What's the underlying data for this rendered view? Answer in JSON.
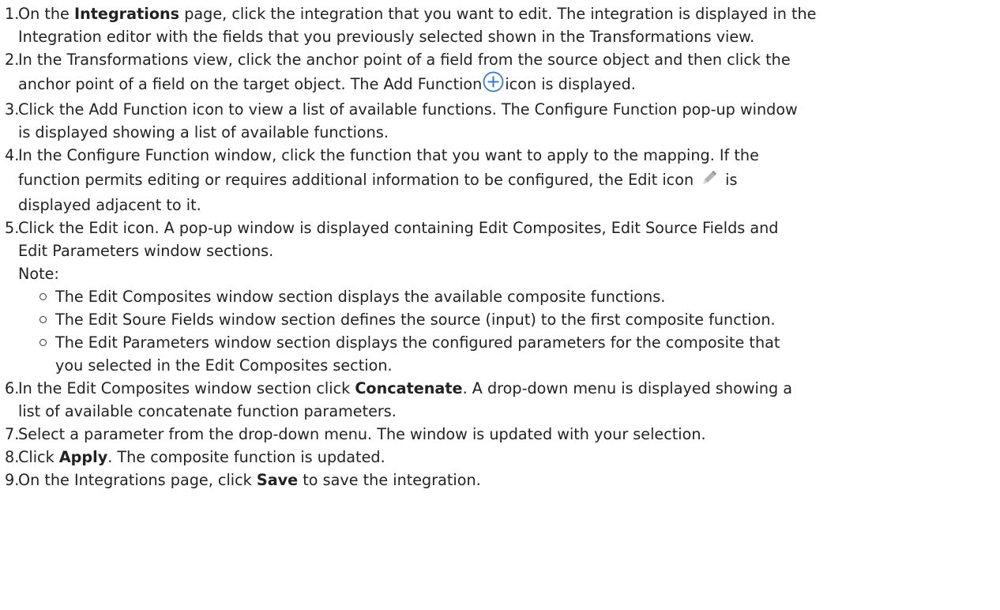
{
  "steps": [
    {
      "num": "1.",
      "a": "On the ",
      "b": "Integrations",
      "c": " page, click the integration that you want to edit. The integration is displayed in the",
      "d": "Integration editor with the fields that you previously selected shown in the Transformations view."
    },
    {
      "num": "2.",
      "a": "In the Transformations view, click the anchor point of a field from the source object and then click the",
      "b": "anchor point of a field on the target object. The Add Function",
      "c": "icon is displayed."
    },
    {
      "num": "3.",
      "a": "Click the Add Function icon to view a list of available functions. The Configure Function pop-up window",
      "b": "is displayed showing a list of available functions."
    },
    {
      "num": "4.",
      "a": "In the Configure Function window, click the function that you want to apply to the mapping. If the",
      "b": "function permits editing or requires additional information to be configured, the Edit icon",
      "c": "is",
      "d": "displayed adjacent to it."
    },
    {
      "num": "5.",
      "a": "Click the Edit icon. A pop-up window is displayed containing Edit Composites, Edit Source Fields and",
      "b": "Edit Parameters window sections.",
      "note_label": "Note:",
      "notes": [
        "The Edit Composites window section displays the available composite functions.",
        "The Edit Soure Fields window section defines the source (input) to the first composite function.",
        "The Edit Parameters window section displays the configured parameters for the composite that",
        "you selected in the Edit Composites section."
      ]
    },
    {
      "num": "6.",
      "a": "In the Edit Composites window section click ",
      "b": "Concatenate",
      "c": ". A drop-down menu is displayed showing a",
      "d": "list of available concatenate function parameters."
    },
    {
      "num": "7.",
      "a": "Select a parameter from the drop-down menu. The window is updated with your selection."
    },
    {
      "num": "8.",
      "a": "Click ",
      "b": "Apply",
      "c": ". The composite function is updated."
    },
    {
      "num": "9.",
      "a": "On the Integrations page, click ",
      "b": "Save",
      "c": " to save the integration."
    }
  ],
  "icons": {
    "add": "plus-circle-icon",
    "edit": "pencil-icon",
    "add_color": "#3c78c8",
    "edit_color": "#9a9a9a"
  }
}
